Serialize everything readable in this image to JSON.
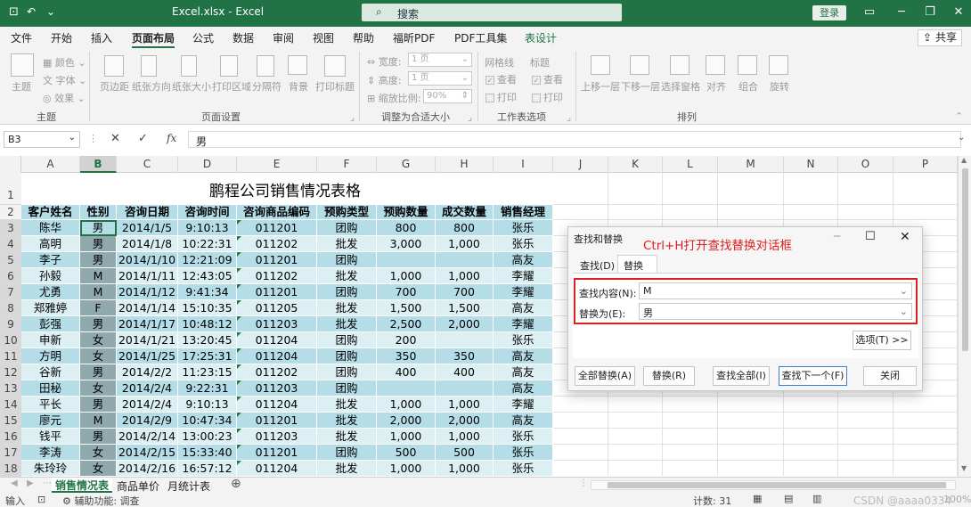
{
  "window": {
    "title": "Excel.xlsx  -  Excel",
    "search_placeholder": "搜索",
    "login": "登录"
  },
  "menu": [
    "文件",
    "开始",
    "插入",
    "页面布局",
    "公式",
    "数据",
    "审阅",
    "视图",
    "帮助",
    "福昕PDF",
    "PDF工具集",
    "表设计"
  ],
  "active_menu": "页面布局",
  "share": "共享",
  "ribbon": {
    "theme_group": {
      "themes": "主题",
      "colors": "颜色",
      "fonts": "字体",
      "effects": "效果",
      "label": "主题"
    },
    "page_setup": {
      "items": [
        "页边距",
        "纸张方向",
        "纸张大小",
        "打印区域",
        "分隔符",
        "背景",
        "打印标题"
      ],
      "label": "页面设置"
    },
    "scale": {
      "width": "宽度:",
      "width_val": "1 页",
      "height": "高度:",
      "height_val": "1 页",
      "scale": "缩放比例:",
      "scale_val": "90%",
      "label": "调整为合适大小"
    },
    "sheet_options": {
      "gridlines": "网格线",
      "headings": "标题",
      "view": "查看",
      "print": "打印",
      "label": "工作表选项"
    },
    "arrange": {
      "items": [
        "上移一层",
        "下移一层",
        "选择窗格",
        "对齐",
        "组合",
        "旋转"
      ],
      "label": "排列"
    }
  },
  "formula_bar": {
    "name_box": "B3",
    "content": "男"
  },
  "columns": [
    "A",
    "B",
    "C",
    "D",
    "E",
    "F",
    "G",
    "H",
    "I",
    "J",
    "K",
    "L",
    "M",
    "N",
    "O",
    "P"
  ],
  "sheet_title": "鹏程公司销售情况表格",
  "table_headers": [
    "客户姓名",
    "性别",
    "咨询日期",
    "咨询时间",
    "咨询商品编码",
    "预购类型",
    "预购数量",
    "成交数量",
    "销售经理"
  ],
  "rows": [
    [
      "陈华",
      "男",
      "2014/1/5",
      "9:10:13",
      "011201",
      "团购",
      "800",
      "800",
      "张乐"
    ],
    [
      "高明",
      "男",
      "2014/1/8",
      "10:22:31",
      "011202",
      "批发",
      "3,000",
      "1,000",
      "张乐"
    ],
    [
      "李子",
      "男",
      "2014/1/10",
      "12:21:09",
      "011201",
      "团购",
      "",
      "",
      "高友"
    ],
    [
      "孙毅",
      "M",
      "2014/1/11",
      "12:43:05",
      "011202",
      "批发",
      "1,000",
      "1,000",
      "李耀"
    ],
    [
      "尤勇",
      "M",
      "2014/1/12",
      "9:41:34",
      "011201",
      "团购",
      "700",
      "700",
      "李耀"
    ],
    [
      "郑雅婷",
      "F",
      "2014/1/14",
      "15:10:35",
      "011205",
      "批发",
      "1,500",
      "1,500",
      "高友"
    ],
    [
      "彭强",
      "男",
      "2014/1/17",
      "10:48:12",
      "011203",
      "批发",
      "2,500",
      "2,000",
      "李耀"
    ],
    [
      "申新",
      "女",
      "2014/1/21",
      "13:20:45",
      "011204",
      "团购",
      "200",
      "",
      "张乐"
    ],
    [
      "方明",
      "女",
      "2014/1/25",
      "17:25:31",
      "011204",
      "团购",
      "350",
      "350",
      "高友"
    ],
    [
      "谷新",
      "男",
      "2014/2/2",
      "11:23:15",
      "011202",
      "团购",
      "400",
      "400",
      "高友"
    ],
    [
      "田秘",
      "女",
      "2014/2/4",
      "9:22:31",
      "011203",
      "团购",
      "",
      "",
      "高友"
    ],
    [
      "平长",
      "男",
      "2014/2/4",
      "9:10:13",
      "011204",
      "批发",
      "1,000",
      "1,000",
      "李耀"
    ],
    [
      "廖元",
      "M",
      "2014/2/9",
      "10:47:34",
      "011201",
      "批发",
      "2,000",
      "2,000",
      "高友"
    ],
    [
      "钱平",
      "男",
      "2014/2/14",
      "13:00:23",
      "011203",
      "批发",
      "1,000",
      "1,000",
      "张乐"
    ],
    [
      "李涛",
      "女",
      "2014/2/15",
      "15:33:40",
      "011201",
      "团购",
      "500",
      "500",
      "张乐"
    ],
    [
      "朱玲玲",
      "女",
      "2014/2/16",
      "16:57:12",
      "011204",
      "批发",
      "1,000",
      "1,000",
      "张乐"
    ]
  ],
  "row_numbers": [
    "1",
    "2",
    "3",
    "4",
    "5",
    "6",
    "7",
    "8",
    "9",
    "10",
    "11",
    "12",
    "13",
    "14",
    "15",
    "16",
    "17",
    "18"
  ],
  "dialog": {
    "title": "查找和替换",
    "annotation": "Ctrl+H打开查找替换对话框",
    "tab_find": "查找(D)",
    "tab_replace": "替换(P)",
    "find_label": "查找内容(N):",
    "find_value": "M",
    "replace_label": "替换为(E):",
    "replace_value": "男",
    "options": "选项(T) >>",
    "buttons": [
      "全部替换(A)",
      "替换(R)",
      "查找全部(I)",
      "查找下一个(F)",
      "关闭"
    ]
  },
  "sheet_tabs": [
    "销售情况表",
    "商品单价",
    "月统计表"
  ],
  "active_tab": "销售情况表",
  "status": {
    "mode": "输入",
    "accessibility": "辅助功能: 调查",
    "count": "计数: 31",
    "watermark": "CSDN @aaaa0334",
    "zoom": "100%"
  },
  "colors": {
    "excel_green": "#217346",
    "band_dark": "#b4dde8",
    "band_light": "#dcf0f4",
    "selected_col": "#8fa9ad",
    "annotation_red": "#e02020"
  }
}
